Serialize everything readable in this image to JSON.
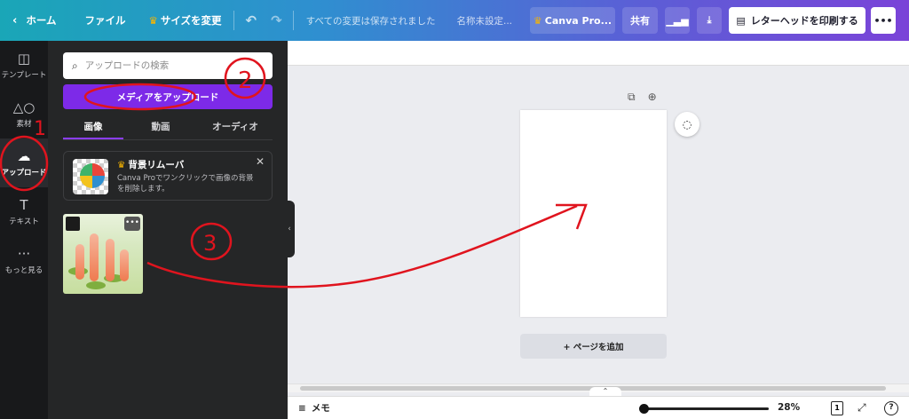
{
  "topbar": {
    "home": "ホーム",
    "file": "ファイル",
    "resize": "サイズを変更",
    "saved_status": "すべての変更は保存されました",
    "doc_title": "名称未設定...",
    "canva_pro": "Canva Pro...",
    "share": "共有",
    "print": "レターヘッドを印刷する"
  },
  "rail": [
    {
      "label": "テンプレート"
    },
    {
      "label": "素材"
    },
    {
      "label": "アップロード"
    },
    {
      "label": "テキスト"
    },
    {
      "label": "もっと見る"
    }
  ],
  "panel": {
    "search_placeholder": "アップロードの検索",
    "upload_button": "メディアをアップロード",
    "tabs": [
      "画像",
      "動画",
      "オーディオ"
    ],
    "promo": {
      "title": "背景リムーバ",
      "desc": "Canva Proでワンクリックで画像の背景を削除します。"
    }
  },
  "canvas": {
    "add_page": "+ ページを追加"
  },
  "bottom": {
    "memo": "メモ",
    "zoom": "28%",
    "page_count": "1",
    "help": "?"
  },
  "annotations": {
    "one": "1",
    "two": "2",
    "three": "3"
  }
}
